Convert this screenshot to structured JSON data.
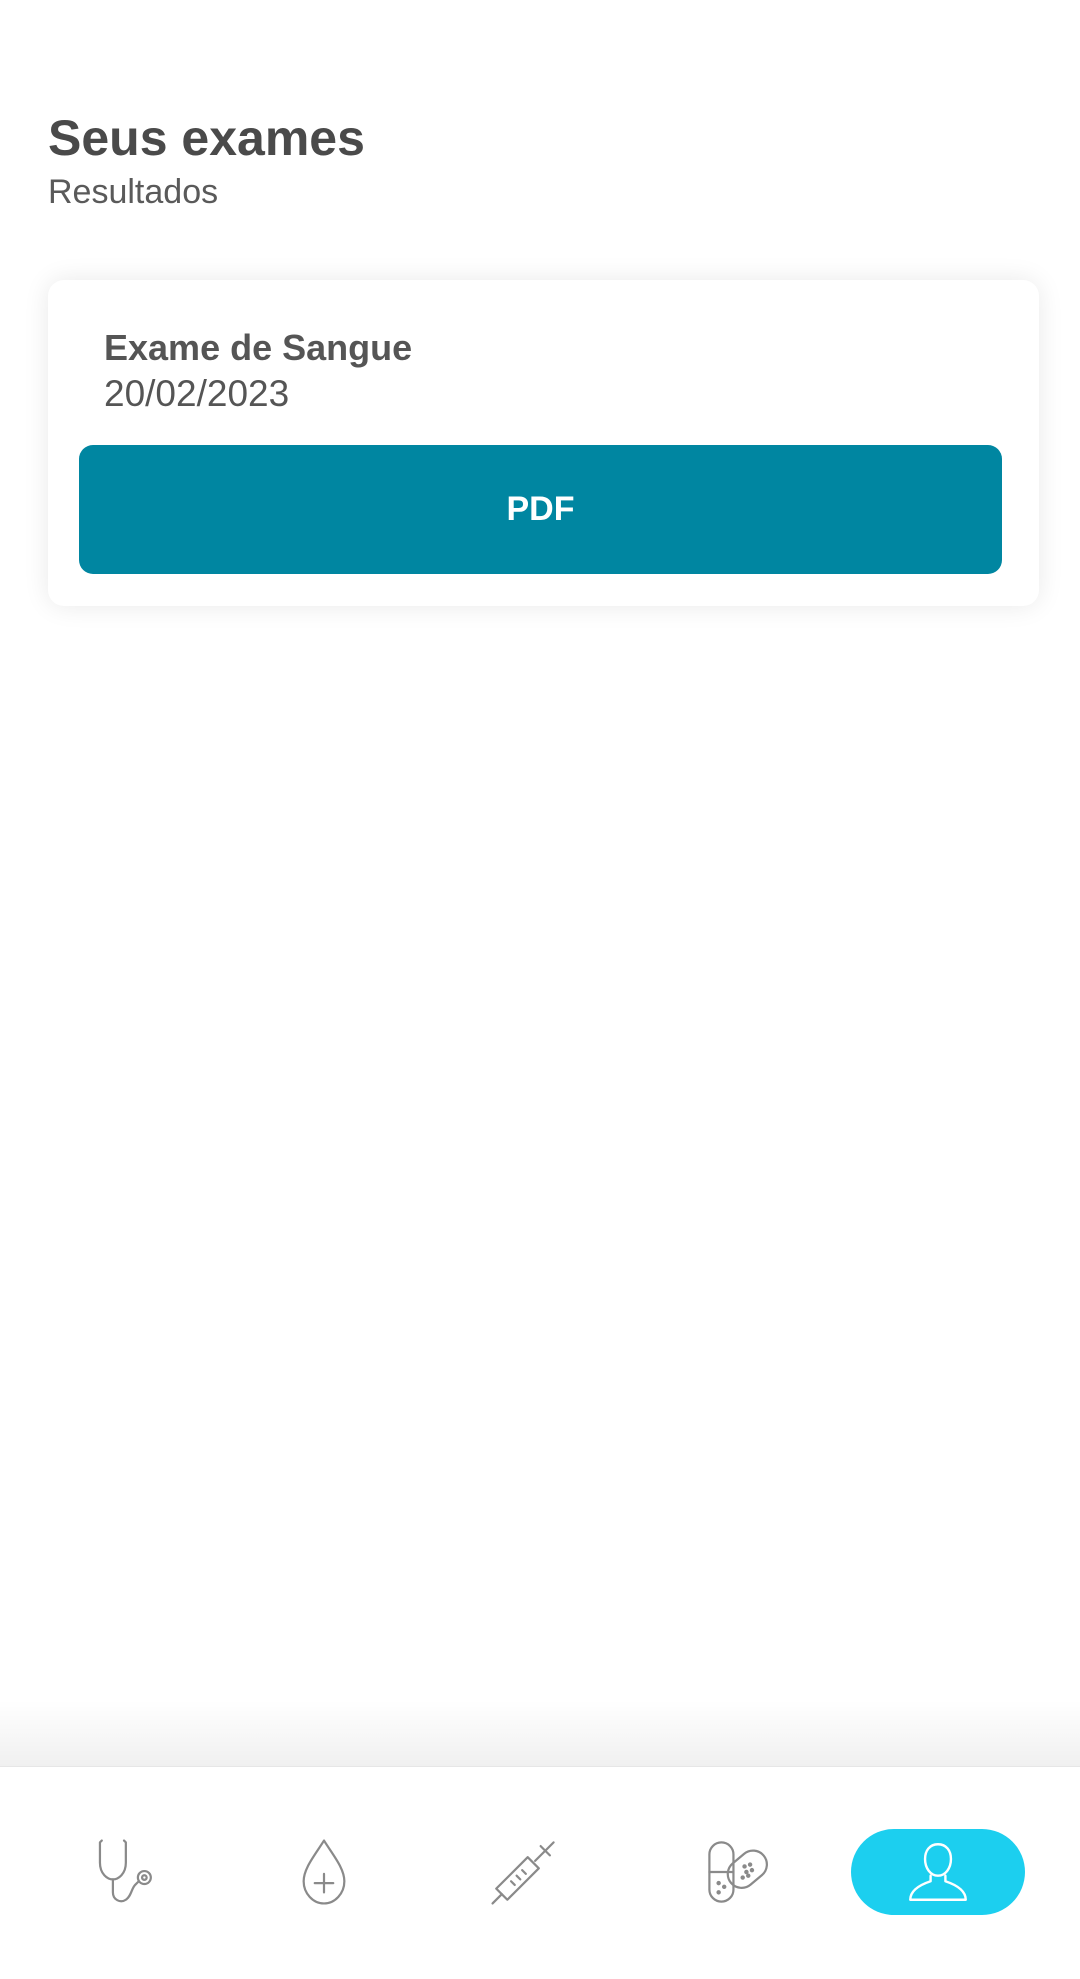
{
  "header": {
    "title": "Seus exames",
    "subtitle": "Resultados"
  },
  "exams": [
    {
      "name": "Exame de Sangue",
      "date": "20/02/2023",
      "button_label": "PDF"
    }
  ],
  "colors": {
    "primary_button": "#0086a1",
    "active_tab": "#1ccfef",
    "text": "#4a4a4a",
    "icon": "#8a8a8a"
  },
  "bottom_nav": {
    "items": [
      {
        "icon": "stethoscope-icon",
        "active": false
      },
      {
        "icon": "blood-drop-icon",
        "active": false
      },
      {
        "icon": "syringe-icon",
        "active": false
      },
      {
        "icon": "pill-bandage-icon",
        "active": false
      },
      {
        "icon": "user-profile-icon",
        "active": true
      }
    ]
  }
}
